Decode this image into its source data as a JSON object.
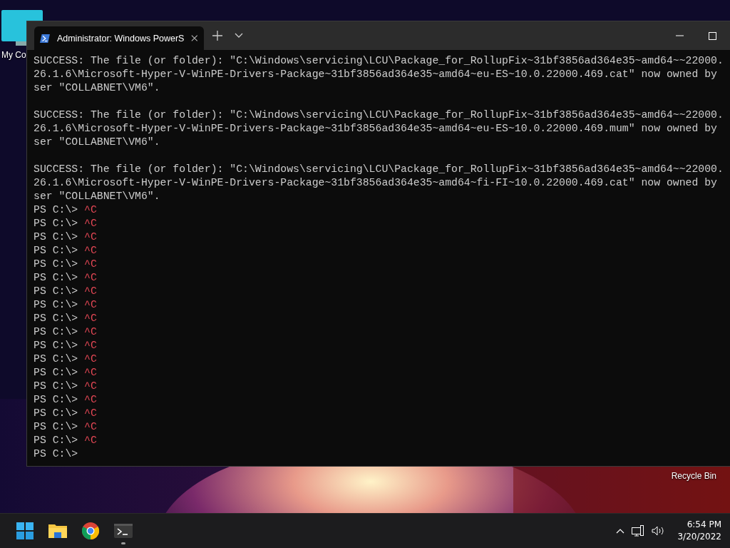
{
  "desktop_icons": [
    {
      "label": "My Co",
      "kind": "computer"
    },
    {
      "label": "Recycle Bin",
      "kind": "bin"
    }
  ],
  "window": {
    "tabs": [
      {
        "title": "Administrator: Windows PowerS",
        "selected": true
      }
    ],
    "lines": [
      {
        "kind": "text",
        "text": "SUCCESS: The file (or folder): \"C:\\Windows\\servicing\\LCU\\Package_for_RollupFix~31bf3856ad364e35~amd64~~22000."
      },
      {
        "kind": "text",
        "text": "26.1.6\\Microsoft-Hyper-V-WinPE-Drivers-Package~31bf3856ad364e35~amd64~eu-ES~10.0.22000.469.cat\" now owned by"
      },
      {
        "kind": "text",
        "text": "ser \"COLLABNET\\VM6\"."
      },
      {
        "kind": "blank"
      },
      {
        "kind": "text",
        "text": "SUCCESS: The file (or folder): \"C:\\Windows\\servicing\\LCU\\Package_for_RollupFix~31bf3856ad364e35~amd64~~22000."
      },
      {
        "kind": "text",
        "text": "26.1.6\\Microsoft-Hyper-V-WinPE-Drivers-Package~31bf3856ad364e35~amd64~eu-ES~10.0.22000.469.mum\" now owned by"
      },
      {
        "kind": "text",
        "text": "ser \"COLLABNET\\VM6\"."
      },
      {
        "kind": "blank"
      },
      {
        "kind": "text",
        "text": "SUCCESS: The file (or folder): \"C:\\Windows\\servicing\\LCU\\Package_for_RollupFix~31bf3856ad364e35~amd64~~22000."
      },
      {
        "kind": "text",
        "text": "26.1.6\\Microsoft-Hyper-V-WinPE-Drivers-Package~31bf3856ad364e35~amd64~fi-FI~10.0.22000.469.cat\" now owned by"
      },
      {
        "kind": "text",
        "text": "ser \"COLLABNET\\VM6\"."
      },
      {
        "kind": "prompt",
        "prompt": "PS C:\\>",
        "input": "^C"
      },
      {
        "kind": "prompt",
        "prompt": "PS C:\\>",
        "input": "^C"
      },
      {
        "kind": "prompt",
        "prompt": "PS C:\\>",
        "input": "^C"
      },
      {
        "kind": "prompt",
        "prompt": "PS C:\\>",
        "input": "^C"
      },
      {
        "kind": "prompt",
        "prompt": "PS C:\\>",
        "input": "^C"
      },
      {
        "kind": "prompt",
        "prompt": "PS C:\\>",
        "input": "^C"
      },
      {
        "kind": "prompt",
        "prompt": "PS C:\\>",
        "input": "^C"
      },
      {
        "kind": "prompt",
        "prompt": "PS C:\\>",
        "input": "^C"
      },
      {
        "kind": "prompt",
        "prompt": "PS C:\\>",
        "input": "^C"
      },
      {
        "kind": "prompt",
        "prompt": "PS C:\\>",
        "input": "^C"
      },
      {
        "kind": "prompt",
        "prompt": "PS C:\\>",
        "input": "^C"
      },
      {
        "kind": "prompt",
        "prompt": "PS C:\\>",
        "input": "^C"
      },
      {
        "kind": "prompt",
        "prompt": "PS C:\\>",
        "input": "^C"
      },
      {
        "kind": "prompt",
        "prompt": "PS C:\\>",
        "input": "^C"
      },
      {
        "kind": "prompt",
        "prompt": "PS C:\\>",
        "input": "^C"
      },
      {
        "kind": "prompt",
        "prompt": "PS C:\\>",
        "input": "^C"
      },
      {
        "kind": "prompt",
        "prompt": "PS C:\\>",
        "input": "^C"
      },
      {
        "kind": "prompt",
        "prompt": "PS C:\\>",
        "input": "^C"
      },
      {
        "kind": "prompt",
        "prompt": "PS C:\\>"
      }
    ]
  },
  "taskbar": {
    "apps": [
      {
        "kind": "start",
        "running": false
      },
      {
        "kind": "explorer",
        "running": false
      },
      {
        "kind": "browser",
        "running": false
      },
      {
        "kind": "terminal",
        "running": true
      }
    ],
    "clock": {
      "time": "6:54 PM",
      "date": "3/20/2022"
    }
  }
}
